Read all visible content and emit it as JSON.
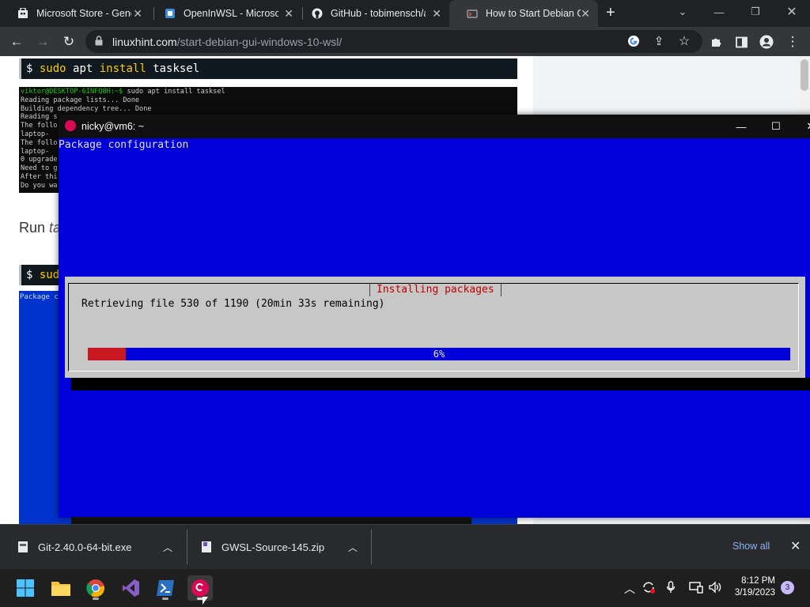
{
  "browser": {
    "tabs": [
      {
        "title": "Microsoft Store - Gene",
        "icon": "microsoft-store-icon",
        "active": false
      },
      {
        "title": "OpenInWSL - Microsoft",
        "icon": "openinwsl-icon",
        "active": false
      },
      {
        "title": "GitHub - tobimensch/a",
        "icon": "github-icon",
        "active": false
      },
      {
        "title": "How to Start Debian G",
        "icon": "linuxhint-icon",
        "active": true
      }
    ],
    "new_tab_label": "+",
    "url_host": "linuxhint.com",
    "url_path": "/start-debian-gui-windows-10-wsl/"
  },
  "webpage": {
    "command_1_prompt": "$",
    "command_1_sudo": "sudo",
    "command_1_rest": " apt ",
    "command_1_install": "install",
    "command_1_pkg": " tasksel",
    "terminal_prompt": "viktor@DESKTOP-6INFQ8H:~$",
    "terminal_cmd": " sudo apt install tasksel",
    "terminal_lines": [
      "Reading package lists... Done",
      "Building dependency tree... Done",
      "Reading s",
      "The follo",
      "  laptop-",
      "The follo",
      "  laptop-",
      "0 upgrade",
      "Need to g",
      "After thi",
      "Do you wa"
    ],
    "run_text": "Run ",
    "run_italic": "ta",
    "command_2_prompt": "$",
    "command_2_text": "sudo",
    "blue_shot_text": "Package co"
  },
  "terminal_window": {
    "title": "nicky@vm6: ~",
    "package_config": "Package configuration",
    "dialog_title": "Installing packages",
    "dialog_message": "Retrieving file 530 of 1190 (20min 33s remaining)",
    "progress_percent": 6,
    "progress_label": "6%"
  },
  "downloads": {
    "items": [
      {
        "name": "Git-2.40.0-64-bit.exe"
      },
      {
        "name": "GWSL-Source-145.zip"
      }
    ],
    "show_all": "Show all"
  },
  "taskbar": {
    "time": "8:12 PM",
    "date": "3/19/2023",
    "notifications": "3"
  },
  "colors": {
    "debian_red": "#d70a53",
    "dialog_blue": "#0000d8",
    "progress_red": "#c81820"
  }
}
